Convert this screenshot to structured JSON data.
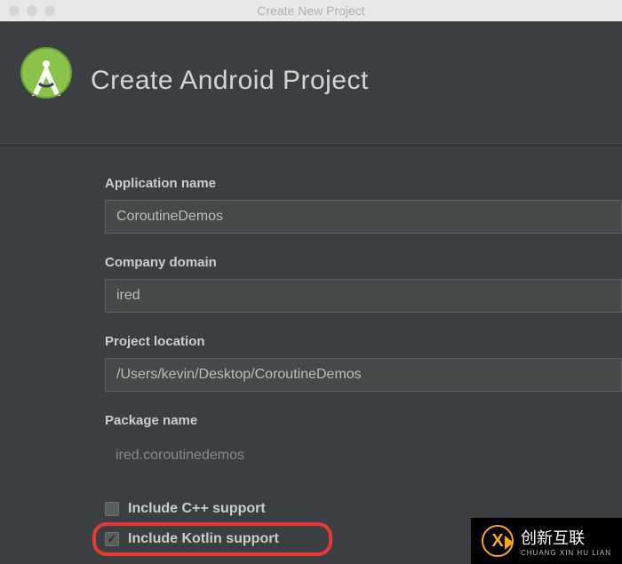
{
  "window": {
    "title": "Create New Project"
  },
  "header": {
    "title": "Create Android Project"
  },
  "form": {
    "app_name": {
      "label": "Application name",
      "value": "CoroutineDemos"
    },
    "company_domain": {
      "label": "Company domain",
      "value": "ired"
    },
    "project_location": {
      "label": "Project location",
      "value": "/Users/kevin/Desktop/CoroutineDemos"
    },
    "package_name": {
      "label": "Package name",
      "value": "ired.coroutinedemos"
    },
    "include_cpp": {
      "label": "Include C++ support",
      "checked": false
    },
    "include_kotlin": {
      "label": "Include Kotlin support",
      "checked": true
    }
  },
  "watermark": {
    "main": "创新互联",
    "sub": "CHUANG XIN HU LIAN"
  }
}
